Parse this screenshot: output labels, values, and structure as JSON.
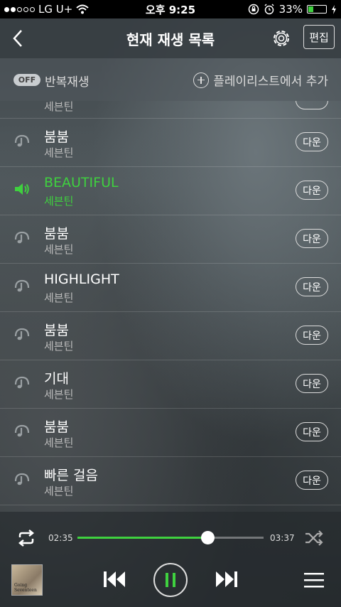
{
  "status": {
    "carrier": "LG U+",
    "time": "오후 9:25",
    "battery": "33%",
    "battery_level": 0.33
  },
  "header": {
    "title": "현재 재생 목록",
    "edit_label": "편집"
  },
  "options": {
    "repeat_toggle": "OFF",
    "repeat_label": "반복재생",
    "add_label": "플레이리스트에서 추가"
  },
  "partial_row": {
    "artist": "세븐틴"
  },
  "list": [
    {
      "title": "붐붐",
      "artist": "세븐틴",
      "download": "다운"
    },
    {
      "title": "BEAUTIFUL",
      "artist": "세븐틴",
      "download": "다운",
      "active": true
    },
    {
      "title": "붐붐",
      "artist": "세븐틴",
      "download": "다운"
    },
    {
      "title": "HIGHLIGHT",
      "artist": "세븐틴",
      "download": "다운"
    },
    {
      "title": "붐붐",
      "artist": "세븐틴",
      "download": "다운"
    },
    {
      "title": "기대",
      "artist": "세븐틴",
      "download": "다운"
    },
    {
      "title": "붐붐",
      "artist": "세븐틴",
      "download": "다운"
    },
    {
      "title": "빠른 걸음",
      "artist": "세븐틴",
      "download": "다운"
    }
  ],
  "player": {
    "current": "02:35",
    "total": "03:37",
    "progress": 0.7,
    "album_caption": "Going Seventeen"
  },
  "colors": {
    "accent": "#3fd13f",
    "navbar": "#373e42"
  }
}
